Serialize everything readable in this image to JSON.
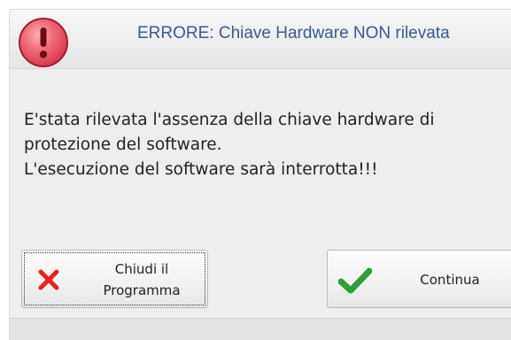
{
  "dialog": {
    "title": "ERRORE: Chiave Hardware NON rilevata",
    "icon": "error-exclamation-icon",
    "message": {
      "line1": "E'stata rilevata l'assenza della chiave hardware di",
      "line2": "protezione del software.",
      "line3": "L'esecuzione del software sarà interrotta!!!"
    },
    "buttons": {
      "close_program": {
        "line1": "Chiudi il",
        "line2": "Programma",
        "icon": "red-x-icon"
      },
      "continue": {
        "label": "Continua",
        "icon": "green-check-icon"
      }
    }
  },
  "colors": {
    "title_text": "#3a5a8c",
    "error_icon": "#e8485a",
    "close_icon": "#e8221e",
    "check_icon": "#2f9e3a"
  }
}
